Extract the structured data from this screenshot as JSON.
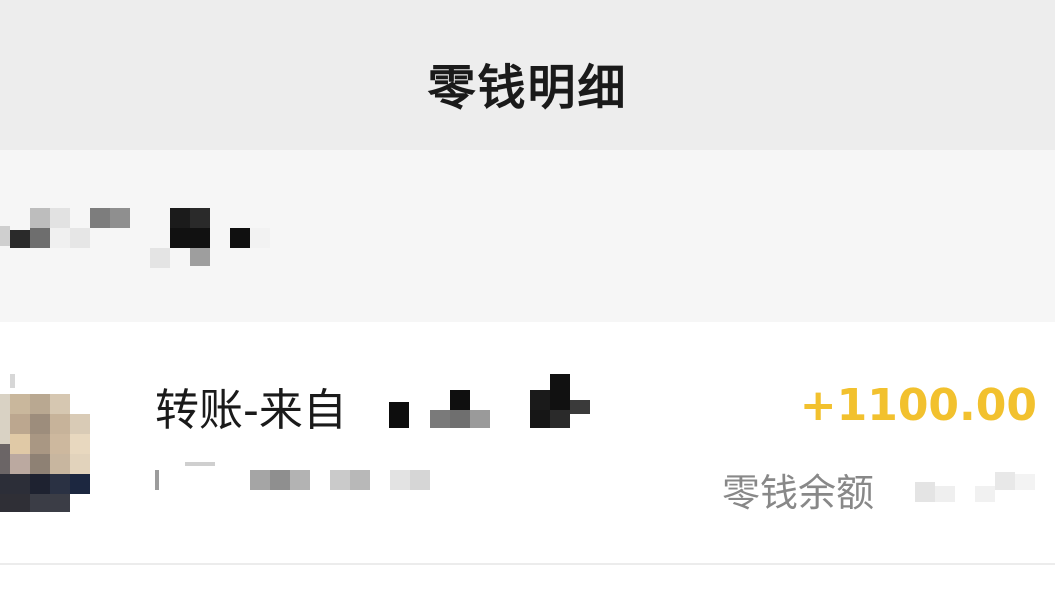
{
  "header": {
    "title": "零钱明细"
  },
  "month_group": {
    "label_redacted": true
  },
  "transactions": [
    {
      "title": "转账-来自",
      "sender_redacted": true,
      "amount": "+1100.00",
      "subtitle_redacted": true,
      "balance_label": "零钱余额",
      "balance_redacted": true
    }
  ],
  "colors": {
    "header_bg": "#ededed",
    "section_bg": "#f6f6f6",
    "income_amount": "#f2c12e",
    "secondary_text": "#888888"
  }
}
